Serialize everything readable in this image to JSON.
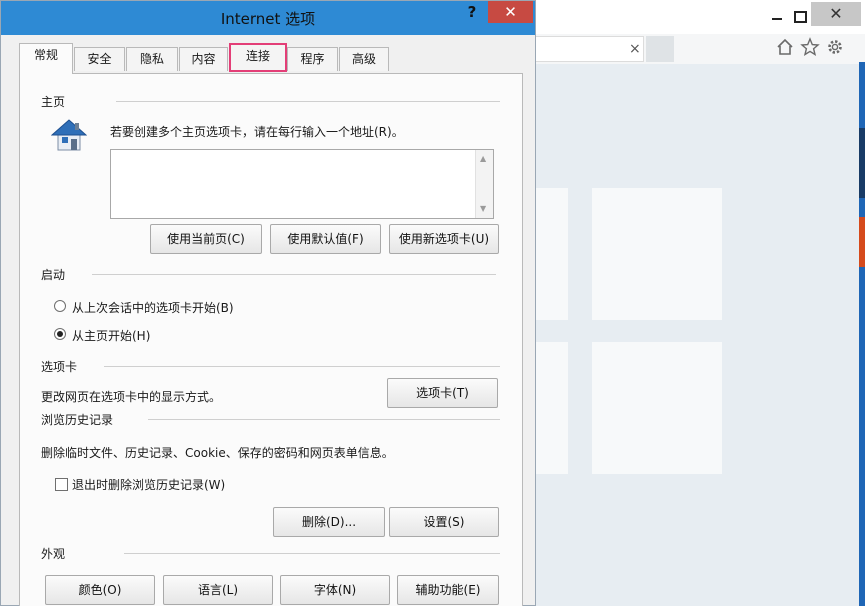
{
  "dialog": {
    "title": "Internet 选项",
    "help_label": "?",
    "close_label": "✕"
  },
  "tabs": [
    {
      "label": "常规"
    },
    {
      "label": "安全"
    },
    {
      "label": "隐私"
    },
    {
      "label": "内容"
    },
    {
      "label": "连接"
    },
    {
      "label": "程序"
    },
    {
      "label": "高级"
    }
  ],
  "homepage": {
    "group_title": "主页",
    "instruction": "若要创建多个主页选项卡，请在每行输入一个地址(R)。",
    "value": "",
    "buttons": {
      "use_current": "使用当前页(C)",
      "use_default": "使用默认值(F)",
      "use_new_tab": "使用新选项卡(U)"
    }
  },
  "startup": {
    "group_title": "启动",
    "options": [
      {
        "label": "从上次会话中的选项卡开始(B)",
        "checked": false
      },
      {
        "label": "从主页开始(H)",
        "checked": true
      }
    ]
  },
  "tabs_section": {
    "group_title": "选项卡",
    "description": "更改网页在选项卡中的显示方式。",
    "button": "选项卡(T)"
  },
  "history": {
    "group_title": "浏览历史记录",
    "description": "删除临时文件、历史记录、Cookie、保存的密码和网页表单信息。",
    "checkbox_label": "退出时删除浏览历史记录(W)",
    "checkbox_checked": false,
    "delete_button": "删除(D)...",
    "settings_button": "设置(S)"
  },
  "appearance": {
    "group_title": "外观",
    "buttons": {
      "colors": "颜色(O)",
      "languages": "语言(L)",
      "fonts": "字体(N)",
      "accessibility": "辅助功能(E)"
    }
  },
  "browser": {
    "tab_close": "×",
    "close_label": "✕"
  },
  "colors": {
    "titlebar": "#2e8ad4",
    "close_button": "#c74a42",
    "highlight_border": "#e33e77"
  }
}
